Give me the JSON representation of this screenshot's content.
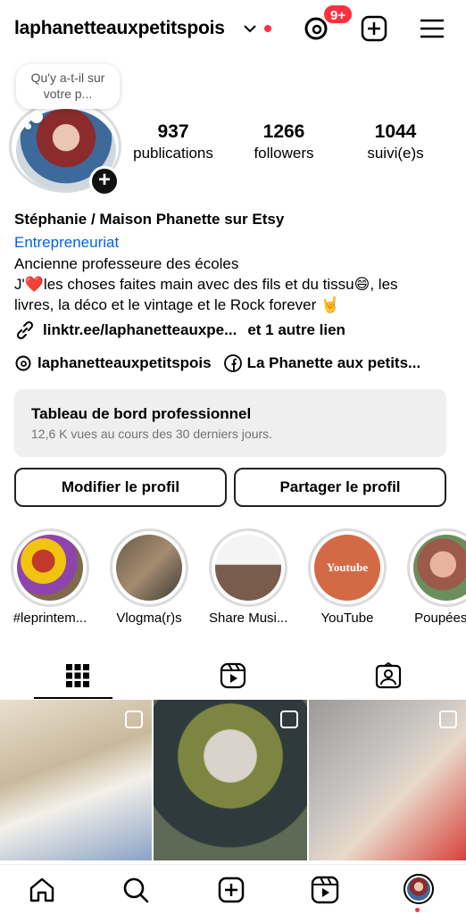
{
  "header": {
    "username": "laphanetteauxpetitspois",
    "threads_badge": "9+"
  },
  "note": {
    "text": "Qu'y a-t-il sur votre p..."
  },
  "stats": [
    {
      "num": "937",
      "label": "publications"
    },
    {
      "num": "1266",
      "label": "followers"
    },
    {
      "num": "1044",
      "label": "suivi(e)s"
    }
  ],
  "bio": {
    "name": "Stéphanie / Maison Phanette sur Etsy",
    "category": "Entrepreneuriat",
    "line1": "Ancienne professeure des écoles",
    "line2_pre": "J'",
    "line2_post": "les choses faites main avec des fils et du tissu😄, les",
    "line3": "livres, la déco et le vintage et le Rock forever 🤘",
    "link": "linktr.ee/laphanetteauxpe...",
    "link_extra": "et 1 autre lien",
    "threads_handle": "laphanetteauxpetitspois",
    "facebook_name": "La Phanette aux petits..."
  },
  "dashboard": {
    "title": "Tableau de bord professionnel",
    "subtitle": "12,6 K vues au cours des 30 derniers jours."
  },
  "buttons": {
    "edit": "Modifier le profil",
    "share": "Partager le profil"
  },
  "highlights": [
    {
      "label": "#leprintem..."
    },
    {
      "label": "Vlogma(r)s"
    },
    {
      "label": "Share Musi..."
    },
    {
      "label": "YouTube"
    },
    {
      "label": "Poupées d"
    }
  ],
  "highlight_youtube_text": "Youtube",
  "colors": {
    "accent_blue": "#0064e0",
    "notification_red": "#ff3040",
    "dashboard_bg": "#efefef"
  },
  "icons": [
    "chevron-down-icon",
    "threads-icon",
    "create-icon",
    "menu-icon",
    "link-icon",
    "facebook-icon",
    "grid-icon",
    "reels-icon",
    "tagged-icon",
    "home-icon",
    "search-icon",
    "reels-nav-icon"
  ]
}
